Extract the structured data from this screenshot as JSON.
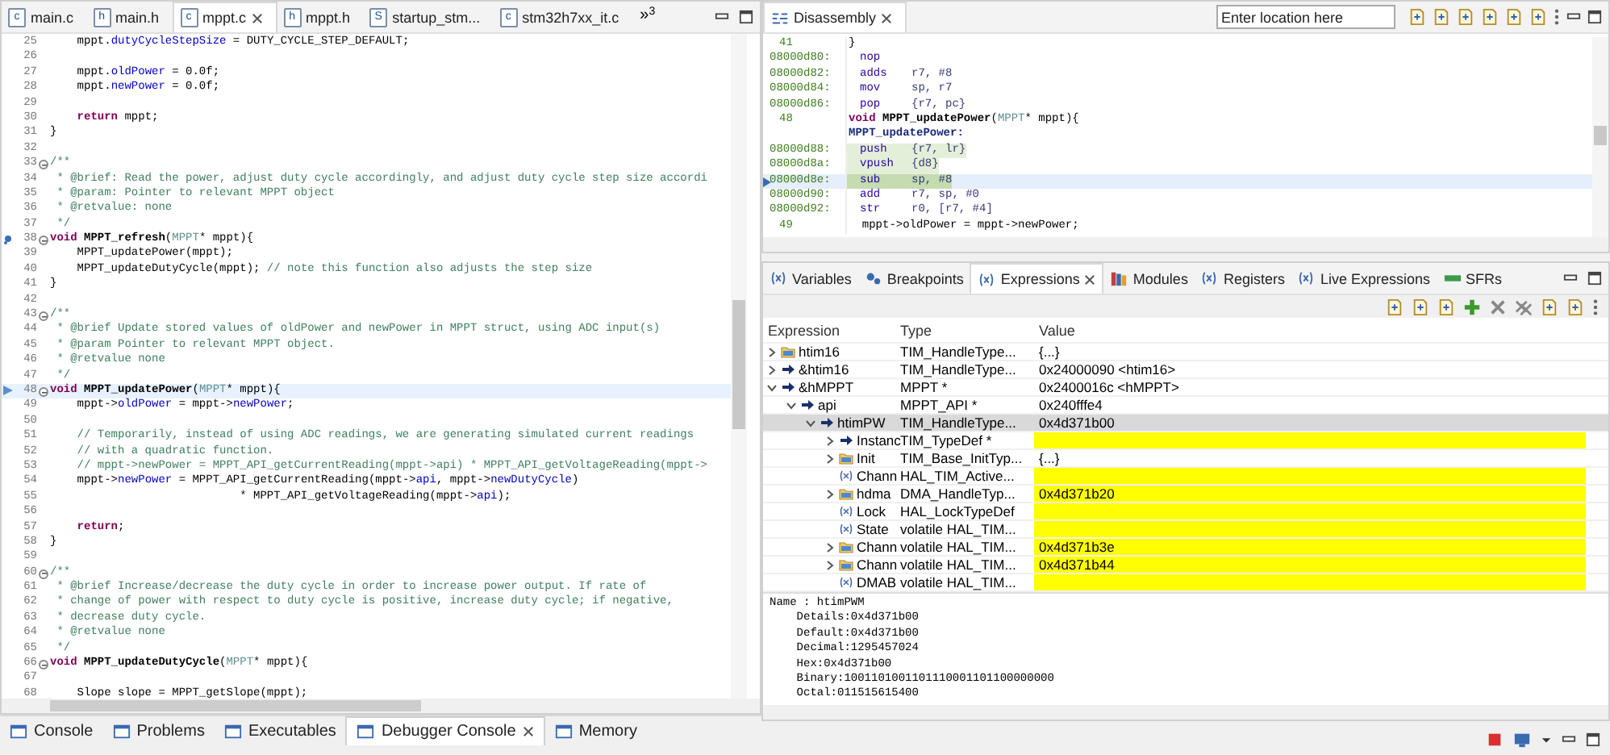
{
  "editor": {
    "tabs": [
      {
        "label": "main.c",
        "icon": "c",
        "selected": false,
        "closable": false
      },
      {
        "label": "main.h",
        "icon": "h",
        "selected": false,
        "closable": false
      },
      {
        "label": "mppt.c",
        "icon": "c",
        "selected": true,
        "closable": true
      },
      {
        "label": "mppt.h",
        "icon": "h",
        "selected": false,
        "closable": false
      },
      {
        "label": "startup_stm...",
        "icon": "S",
        "selected": false,
        "closable": false
      },
      {
        "label": "stm32h7xx_it.c",
        "icon": "c",
        "selected": false,
        "closable": false
      }
    ],
    "overflow": "»",
    "overflow_count": "3",
    "lines": [
      {
        "num": "25",
        "fold": false,
        "current": false,
        "pinned": false,
        "tokens": [
          {
            "kind": "plain",
            "text": "    mppt."
          },
          {
            "kind": "field",
            "text": "dutyCycleStepSize"
          },
          {
            "kind": "plain",
            "text": " = DUTY_CYCLE_STEP_DEFAULT;"
          }
        ]
      },
      {
        "num": "26",
        "fold": false,
        "current": false,
        "pinned": false
      },
      {
        "num": "27",
        "fold": false,
        "current": false,
        "pinned": false,
        "tokens": [
          {
            "kind": "plain",
            "text": "    mppt."
          },
          {
            "kind": "field",
            "text": "oldPower"
          },
          {
            "kind": "plain",
            "text": " = 0.0f;"
          }
        ]
      },
      {
        "num": "28",
        "fold": false,
        "current": false,
        "pinned": false,
        "tokens": [
          {
            "kind": "plain",
            "text": "    mppt."
          },
          {
            "kind": "field",
            "text": "newPower"
          },
          {
            "kind": "plain",
            "text": " = 0.0f;"
          }
        ]
      },
      {
        "num": "29",
        "fold": false,
        "current": false,
        "pinned": false
      },
      {
        "num": "30",
        "fold": false,
        "current": false,
        "pinned": false,
        "tokens": [
          {
            "kind": "keyword",
            "text": "    return"
          },
          {
            "kind": "plain",
            "text": " mppt;"
          }
        ]
      },
      {
        "num": "31",
        "fold": false,
        "current": false,
        "pinned": false,
        "tokens": [
          {
            "kind": "plain",
            "text": "}"
          }
        ]
      },
      {
        "num": "32",
        "fold": false,
        "current": false,
        "pinned": false
      },
      {
        "num": "33",
        "fold": true,
        "current": false,
        "pinned": false,
        "tokens": [
          {
            "kind": "comment",
            "text": "/**"
          }
        ]
      },
      {
        "num": "34",
        "fold": false,
        "current": false,
        "pinned": false,
        "tokens": [
          {
            "kind": "comment",
            "text": " * @brief: Read the power, adjust duty cycle accordingly, and adjust duty cycle step size accordi"
          }
        ]
      },
      {
        "num": "35",
        "fold": false,
        "current": false,
        "pinned": false,
        "tokens": [
          {
            "kind": "comment",
            "text": " * @param: Pointer to relevant MPPT object"
          }
        ]
      },
      {
        "num": "36",
        "fold": false,
        "current": false,
        "pinned": false,
        "tokens": [
          {
            "kind": "comment",
            "text": " * @retvalue: none"
          }
        ]
      },
      {
        "num": "37",
        "fold": false,
        "current": false,
        "pinned": false,
        "tokens": [
          {
            "kind": "comment",
            "text": " */"
          }
        ]
      },
      {
        "num": "38",
        "fold": true,
        "current": false,
        "pinned": true,
        "tokens": [
          {
            "kind": "keyword",
            "text": "void"
          },
          {
            "kind": "function",
            "text": " MPPT_refresh"
          },
          {
            "kind": "plain",
            "text": "("
          },
          {
            "kind": "type",
            "text": "MPPT"
          },
          {
            "kind": "plain",
            "text": "* mppt){"
          }
        ]
      },
      {
        "num": "39",
        "fold": false,
        "current": false,
        "pinned": false,
        "tokens": [
          {
            "kind": "plain",
            "text": "    MPPT_updatePower(mppt);"
          }
        ]
      },
      {
        "num": "40",
        "fold": false,
        "current": false,
        "pinned": false,
        "tokens": [
          {
            "kind": "plain",
            "text": "    MPPT_updateDutyCycle(mppt);"
          },
          {
            "kind": "comment",
            "text": " // note this function also adjusts the step size"
          }
        ]
      },
      {
        "num": "41",
        "fold": false,
        "current": false,
        "pinned": false,
        "tokens": [
          {
            "kind": "plain",
            "text": "}"
          }
        ]
      },
      {
        "num": "42",
        "fold": false,
        "current": false,
        "pinned": false
      },
      {
        "num": "43",
        "fold": true,
        "current": false,
        "pinned": false,
        "tokens": [
          {
            "kind": "comment",
            "text": "/**"
          }
        ]
      },
      {
        "num": "44",
        "fold": false,
        "current": false,
        "pinned": false,
        "tokens": [
          {
            "kind": "comment",
            "text": " * @brief Update stored values of oldPower and newPower in MPPT struct, using ADC input(s)"
          }
        ]
      },
      {
        "num": "45",
        "fold": false,
        "current": false,
        "pinned": false,
        "tokens": [
          {
            "kind": "comment",
            "text": " * @param Pointer to relevant MPPT object."
          }
        ]
      },
      {
        "num": "46",
        "fold": false,
        "current": false,
        "pinned": false,
        "tokens": [
          {
            "kind": "comment",
            "text": " * @retvalue none"
          }
        ]
      },
      {
        "num": "47",
        "fold": false,
        "current": false,
        "pinned": false,
        "tokens": [
          {
            "kind": "comment",
            "text": " */"
          }
        ]
      },
      {
        "num": "48",
        "fold": true,
        "current": true,
        "pinned": false,
        "tokens": [
          {
            "kind": "keyword",
            "text": "void"
          },
          {
            "kind": "function",
            "text": " MPPT_updatePower"
          },
          {
            "kind": "plain",
            "text": "("
          },
          {
            "kind": "type",
            "text": "MPPT"
          },
          {
            "kind": "plain",
            "text": "* mppt){"
          }
        ]
      },
      {
        "num": "49",
        "fold": false,
        "current": false,
        "pinned": false,
        "tokens": [
          {
            "kind": "plain",
            "text": "    mppt->"
          },
          {
            "kind": "field",
            "text": "oldPower"
          },
          {
            "kind": "plain",
            "text": " = mppt->"
          },
          {
            "kind": "field",
            "text": "newPower"
          },
          {
            "kind": "plain",
            "text": ";"
          }
        ]
      },
      {
        "num": "50",
        "fold": false,
        "current": false,
        "pinned": false
      },
      {
        "num": "51",
        "fold": false,
        "current": false,
        "pinned": false,
        "tokens": [
          {
            "kind": "comment",
            "text": "    // Temporarily, instead of using ADC readings, we are generating simulated current readings"
          }
        ]
      },
      {
        "num": "52",
        "fold": false,
        "current": false,
        "pinned": false,
        "tokens": [
          {
            "kind": "comment",
            "text": "    // with a quadratic function."
          }
        ]
      },
      {
        "num": "53",
        "fold": false,
        "current": false,
        "pinned": false,
        "tokens": [
          {
            "kind": "comment",
            "text": "    // mppt->newPower = MPPT_API_getCurrentReading(mppt->api) * MPPT_API_getVoltageReading(mppt->"
          }
        ]
      },
      {
        "num": "54",
        "fold": false,
        "current": false,
        "pinned": false,
        "tokens": [
          {
            "kind": "plain",
            "text": "    mppt->"
          },
          {
            "kind": "field",
            "text": "newPower"
          },
          {
            "kind": "plain",
            "text": " = MPPT_API_getCurrentReading(mppt->"
          },
          {
            "kind": "field",
            "text": "api"
          },
          {
            "kind": "plain",
            "text": ", mppt->"
          },
          {
            "kind": "field",
            "text": "newDutyCycle"
          },
          {
            "kind": "plain",
            "text": ")"
          }
        ]
      },
      {
        "num": "55",
        "fold": false,
        "current": false,
        "pinned": false,
        "tokens": [
          {
            "kind": "plain",
            "text": "                            * MPPT_API_getVoltageReading(mppt->"
          },
          {
            "kind": "field",
            "text": "api"
          },
          {
            "kind": "plain",
            "text": ");"
          }
        ]
      },
      {
        "num": "56",
        "fold": false,
        "current": false,
        "pinned": false
      },
      {
        "num": "57",
        "fold": false,
        "current": false,
        "pinned": false,
        "tokens": [
          {
            "kind": "keyword",
            "text": "    return"
          },
          {
            "kind": "plain",
            "text": ";"
          }
        ]
      },
      {
        "num": "58",
        "fold": false,
        "current": false,
        "pinned": false,
        "tokens": [
          {
            "kind": "plain",
            "text": "}"
          }
        ]
      },
      {
        "num": "59",
        "fold": false,
        "current": false,
        "pinned": false
      },
      {
        "num": "60",
        "fold": true,
        "current": false,
        "pinned": false,
        "tokens": [
          {
            "kind": "comment",
            "text": "/**"
          }
        ]
      },
      {
        "num": "61",
        "fold": false,
        "current": false,
        "pinned": false,
        "tokens": [
          {
            "kind": "comment",
            "text": " * @brief Increase/decrease the duty cycle in order to increase power output. If rate of"
          }
        ]
      },
      {
        "num": "62",
        "fold": false,
        "current": false,
        "pinned": false,
        "tokens": [
          {
            "kind": "comment",
            "text": " * change of power with respect to duty cycle is positive, increase duty cycle; if negative,"
          }
        ]
      },
      {
        "num": "63",
        "fold": false,
        "current": false,
        "pinned": false,
        "tokens": [
          {
            "kind": "comment",
            "text": " * decrease duty cycle."
          }
        ]
      },
      {
        "num": "64",
        "fold": false,
        "current": false,
        "pinned": false,
        "tokens": [
          {
            "kind": "comment",
            "text": " * @retvalue none"
          }
        ]
      },
      {
        "num": "65",
        "fold": false,
        "current": false,
        "pinned": false,
        "tokens": [
          {
            "kind": "comment",
            "text": " */"
          }
        ]
      },
      {
        "num": "66",
        "fold": true,
        "current": false,
        "pinned": false,
        "tokens": [
          {
            "kind": "keyword",
            "text": "void"
          },
          {
            "kind": "function",
            "text": " MPPT_updateDutyCycle"
          },
          {
            "kind": "plain",
            "text": "("
          },
          {
            "kind": "type",
            "text": "MPPT"
          },
          {
            "kind": "plain",
            "text": "* mppt){"
          }
        ]
      },
      {
        "num": "67",
        "fold": false,
        "current": false,
        "pinned": false
      },
      {
        "num": "68",
        "fold": false,
        "current": false,
        "pinned": false,
        "tokens": [
          {
            "kind": "plain",
            "text": "    Slope slope = MPPT_getSlope(mppt);"
          }
        ]
      }
    ]
  },
  "bottom_tabs": [
    {
      "label": "Console",
      "selected": false,
      "closable": false
    },
    {
      "label": "Problems",
      "selected": false,
      "closable": false
    },
    {
      "label": "Executables",
      "selected": false,
      "closable": false
    },
    {
      "label": "Debugger Console",
      "selected": true,
      "closable": true
    },
    {
      "label": "Memory",
      "selected": false,
      "closable": false
    }
  ],
  "disassembly": {
    "tab": "Disassembly",
    "location": {
      "placeholder": "Enter location here"
    },
    "rows": [
      {
        "kind": "source",
        "addr": "41",
        "tokens": [
          {
            "kind": "plain",
            "text": "}"
          }
        ]
      },
      {
        "kind": "instr",
        "addr": "08000d80:",
        "op": "nop",
        "selected": false,
        "highlighted": false
      },
      {
        "kind": "instr",
        "addr": "08000d82:",
        "op": "adds",
        "args": "r7, #8",
        "selected": false,
        "highlighted": false
      },
      {
        "kind": "instr",
        "addr": "08000d84:",
        "op": "mov",
        "args": "sp, r7",
        "selected": false,
        "highlighted": false
      },
      {
        "kind": "instr",
        "addr": "08000d86:",
        "op": "pop",
        "args": "{r7, pc}",
        "selected": false,
        "highlighted": false
      },
      {
        "kind": "source",
        "addr": "48",
        "tokens": [
          {
            "kind": "keyword",
            "text": "void"
          },
          {
            "kind": "function",
            "text": " MPPT_updatePower"
          },
          {
            "kind": "plain",
            "text": "("
          },
          {
            "kind": "type",
            "text": "MPPT"
          },
          {
            "kind": "plain",
            "text": "* mppt){"
          }
        ]
      },
      {
        "kind": "label",
        "label": "MPPT_updatePower:"
      },
      {
        "kind": "instr",
        "addr": "08000d88:",
        "op": "push",
        "args": "{r7, lr}",
        "selected": false,
        "highlighted": true
      },
      {
        "kind": "instr",
        "addr": "08000d8a:",
        "op": "vpush",
        "args": "{d8}",
        "selected": false,
        "highlighted": true
      },
      {
        "kind": "instr",
        "addr": "08000d8e:",
        "op": "sub",
        "args": "sp, #8",
        "selected": true,
        "highlighted": true
      },
      {
        "kind": "instr",
        "addr": "08000d90:",
        "op": "add",
        "args": "r7, sp, #0",
        "selected": false,
        "highlighted": false
      },
      {
        "kind": "instr",
        "addr": "08000d92:",
        "op": "str",
        "args": "r0, [r7, #4]",
        "selected": false,
        "highlighted": false
      },
      {
        "kind": "source",
        "addr": "49",
        "tokens": [
          {
            "kind": "plain",
            "text": "  mppt->oldPower = mppt->newPower;"
          }
        ]
      }
    ]
  },
  "debug_tabs": [
    {
      "label": "Variables",
      "selected": false,
      "closable": false
    },
    {
      "label": "Breakpoints",
      "selected": false,
      "closable": false
    },
    {
      "label": "Expressions",
      "selected": true,
      "closable": true
    },
    {
      "label": "Modules",
      "selected": false,
      "closable": false
    },
    {
      "label": "Registers",
      "selected": false,
      "closable": false
    },
    {
      "label": "Live Expressions",
      "selected": false,
      "closable": false
    },
    {
      "label": "SFRs",
      "selected": false,
      "closable": false
    }
  ],
  "expressions": {
    "columns": [
      "Expression",
      "Type",
      "Value"
    ],
    "rows": [
      {
        "name": "htim16",
        "kind": "struct",
        "type": "TIM_HandleType...",
        "value": "{...}",
        "expanded": false,
        "selected": false,
        "changed": false
      },
      {
        "name": "&htim16",
        "kind": "pointer",
        "type": "TIM_HandleType...",
        "value": "0x24000090 <htim16>",
        "expanded": false,
        "selected": false,
        "changed": false
      },
      {
        "name": "&hMPPT",
        "kind": "pointer",
        "type": "MPPT *",
        "value": "0x2400016c <hMPPT>",
        "expanded": true,
        "selected": false,
        "changed": false,
        "children": [
          {
            "name": "api",
            "kind": "pointer",
            "type": "MPPT_API *",
            "value": "0x240fffe4",
            "expanded": true,
            "selected": false,
            "changed": false,
            "children": [
              {
                "name": "htimPW",
                "kind": "pointer",
                "type": "TIM_HandleType...",
                "value": "0x4d371b00",
                "expanded": true,
                "selected": true,
                "changed": false,
                "children": [
                  {
                    "name": "Instanc",
                    "kind": "pointer",
                    "type": "TIM_TypeDef *",
                    "expanded": false,
                    "selected": false,
                    "changed": true
                  },
                  {
                    "name": "Init",
                    "kind": "struct",
                    "type": "TIM_Base_InitTyp...",
                    "value": "{...}",
                    "expanded": false,
                    "selected": false,
                    "changed": false
                  },
                  {
                    "name": "Chann",
                    "kind": "variable",
                    "type": "HAL_TIM_Active...",
                    "selected": false,
                    "changed": true
                  },
                  {
                    "name": "hdma",
                    "kind": "struct",
                    "type": "DMA_HandleTyp...",
                    "value": "0x4d371b20",
                    "expanded": false,
                    "selected": false,
                    "changed": true
                  },
                  {
                    "name": "Lock",
                    "kind": "variable",
                    "type": "HAL_LockTypeDef",
                    "selected": false,
                    "changed": true
                  },
                  {
                    "name": "State",
                    "kind": "variable",
                    "type": "volatile HAL_TIM...",
                    "selected": false,
                    "changed": true
                  },
                  {
                    "name": "Chann",
                    "kind": "struct",
                    "type": "volatile HAL_TIM...",
                    "value": "0x4d371b3e",
                    "expanded": false,
                    "selected": false,
                    "changed": true
                  },
                  {
                    "name": "Chann",
                    "kind": "struct",
                    "type": "volatile HAL_TIM...",
                    "value": "0x4d371b44",
                    "expanded": false,
                    "selected": false,
                    "changed": true
                  },
                  {
                    "name": "DMAB",
                    "kind": "variable",
                    "type": "volatile HAL_TIM...",
                    "selected": false,
                    "changed": true
                  }
                ]
              }
            ]
          }
        ]
      }
    ],
    "details": [
      "Name : htimPWM",
      "    Details:0x4d371b00",
      "    Default:0x4d371b00",
      "    Decimal:1295457024",
      "    Hex:0x4d371b00",
      "    Binary:1001101001101110001101100000000",
      "    Octal:011515615400"
    ]
  }
}
